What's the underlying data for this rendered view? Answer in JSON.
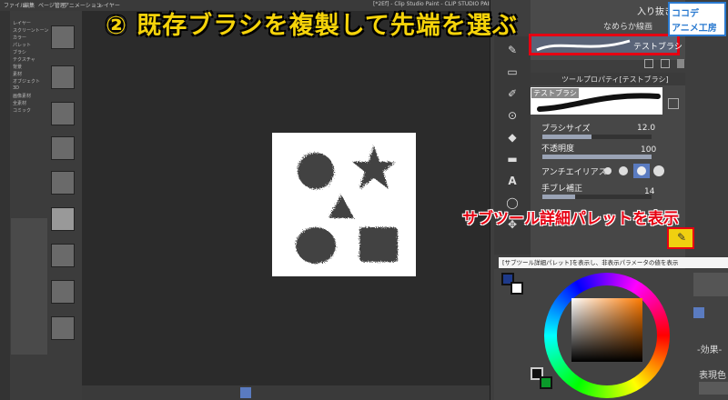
{
  "header": {
    "title": "② 既存ブラシを複製して先端を選ぶ",
    "window_title": "[*2Ef] - Clip Studio Paint - CLIP STUDIO PAINT EX"
  },
  "menubar": {
    "items": [
      "ファイル",
      "編集",
      "ページ管理",
      "アニメーション",
      "レイヤー",
      "選択範囲",
      "表示",
      "フィルター",
      "ウィンドウ",
      "ヘルプ"
    ]
  },
  "left_panel": {
    "items": [
      "レイヤー",
      "スクリーントーン",
      "カラー",
      "パレット",
      "ブラシ",
      "テクスチャ",
      "背景",
      "素材",
      "オブジェクト",
      "3D",
      "画像素材",
      "全素材",
      "コミック"
    ]
  },
  "brush_list": {
    "top_item": "入り抜き",
    "second_item": "なめらか線画",
    "selected_item": "テストブラシ"
  },
  "tool_property": {
    "title": "ツールプロパティ[テストブラシ]",
    "stroke_name": "テストブラシ",
    "brush_size_label": "ブラシサイズ",
    "brush_size_value": "12.0",
    "opacity_label": "不透明度",
    "opacity_value": "100",
    "antialias_label": "アンチエイリアス",
    "stabilization_label": "手ブレ補正",
    "stabilization_value": "14",
    "brush_size_fraction": 0.45,
    "opacity_fraction": 1.0,
    "stabilization_fraction": 0.3
  },
  "annotation": {
    "text": "サブツール詳細パレットを表示"
  },
  "tooltip": {
    "text": "[サブツール詳細パレット]を表示し、非表示パラメータの値を表示"
  },
  "right_side": {
    "effect_label": "-効果-",
    "expression_label": "表現色"
  },
  "logo": {
    "line1": "ココデ",
    "line2": "アニメ工房"
  },
  "colors": {
    "title_yellow": "#f5d30a",
    "highlight_red": "#e60012",
    "panel_bg": "#3e3e3e",
    "canvas_bg": "#2b2b2b",
    "button_yellow": "#f0d010"
  },
  "icons": [
    "pen-icon",
    "eraser-icon",
    "fill-icon",
    "gradient-icon",
    "text-icon",
    "balloon-icon",
    "eyedropper-icon",
    "move-icon",
    "subtool-detail-icon",
    "lock-icon"
  ]
}
